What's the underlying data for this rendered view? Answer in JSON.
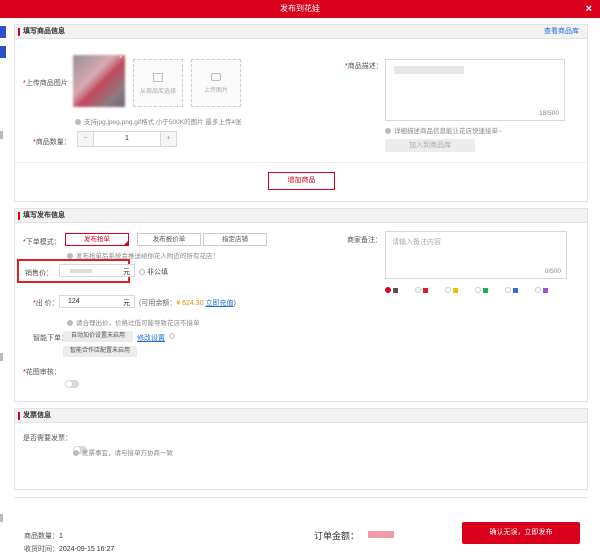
{
  "window": {
    "title": "发布到花娃",
    "close_glyph": "×"
  },
  "product_section": {
    "title": "填写商品信息",
    "link_view_library": "查看商品库",
    "upload_label": "上传商品图片",
    "select_from_library": "从商品库选择",
    "upload_image": "上传图片",
    "upload_hint": "支持jpg,jpeg,png,gif格式,小于500K的图片 最多上传4张",
    "desc_label": "商品描述：",
    "desc_counter": "18/500",
    "desc_hint": "详细描述商品信息能让花店快速接单~",
    "add_to_library": "加入到商品库",
    "qty_label": "商品数量：",
    "qty_minus": "−",
    "qty_value": "1",
    "qty_plus": "+",
    "add_product_button": "增加商品"
  },
  "publish_section": {
    "title": "填写发布信息",
    "mode_label": "下单模式：",
    "modes": [
      "发布抢单",
      "发布报价单",
      "指定店铺"
    ],
    "mode_hint": "发布抢单后系统会推送给你花人附近的所有花店！",
    "sale_price_label": "销售价：",
    "sale_price_unit": "元",
    "not_public": "非公填",
    "price_label": "出  价：",
    "price_value": "124",
    "price_unit": "元",
    "balance_prefix": "(可用余额：",
    "balance_value": "¥ 624.30",
    "recharge": "立即充值",
    "balance_suffix": ")",
    "price_hint": "请合理出价，价格过低可能导致花店不接单",
    "smart_label": "智能下单：",
    "auto_markup": "自动加价设置未启用",
    "modify_settings": "修改设置",
    "smart_coop": "智能合作店配置未启用",
    "review_label": "花图审核：",
    "merchant_note_label": "商家备注：",
    "merchant_note_placeholder": "请输入备注内容",
    "merchant_note_counter": "0/500",
    "flag_colors": [
      "#555555",
      "#e02020",
      "#f0c000",
      "#20b050",
      "#2f6fde",
      "#a050d0"
    ]
  },
  "invoice_section": {
    "title": "发票信息",
    "need_invoice_label": "是否需要发票：",
    "invoice_hint": "发票事宜，请与接单方协商一致"
  },
  "footer": {
    "qty_label": "商品数量：",
    "qty_value": "1",
    "time_label": "收货时间：",
    "time_value": "2024-09-15 16:27",
    "amount_label": "订单金额：",
    "submit_button": "确认无误，立即发布"
  }
}
